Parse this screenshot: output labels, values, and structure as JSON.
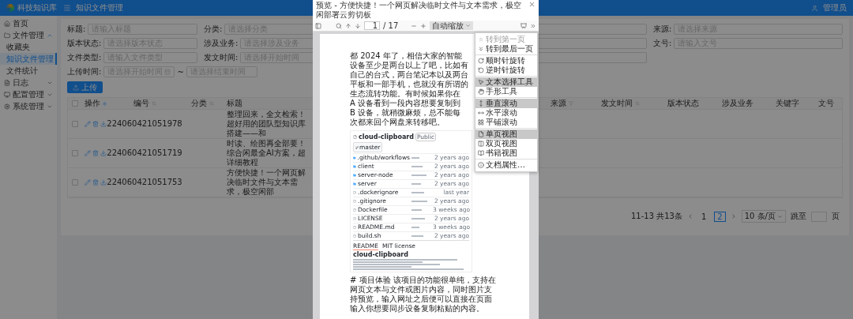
{
  "app": {
    "logo": "科技知识库",
    "breadcrumb": "知识文件管理",
    "user": "管理员"
  },
  "sidebar": {
    "items": [
      {
        "label": "首页",
        "kind": "link",
        "selected": false
      },
      {
        "label": "文件管理",
        "kind": "group",
        "expanded": true,
        "children": [
          {
            "label": "收藏夹",
            "selected": false
          },
          {
            "label": "知识文件管理",
            "selected": true
          },
          {
            "label": "文件统计",
            "selected": false
          }
        ]
      },
      {
        "label": "日志",
        "kind": "group",
        "expanded": false
      },
      {
        "label": "配置管理",
        "kind": "group",
        "expanded": false
      },
      {
        "label": "系统管理",
        "kind": "group",
        "expanded": false
      }
    ]
  },
  "filters": [
    {
      "label": "标题:",
      "kind": "input",
      "placeholder": "请输入标题"
    },
    {
      "label": "分类:",
      "kind": "select",
      "placeholder": "请选择分类"
    },
    {
      "label": "来源:",
      "kind": "select",
      "placeholder": "请选择来源"
    },
    {
      "label": "版本状态:",
      "kind": "select",
      "placeholder": "请选择版本状态"
    },
    {
      "label": "涉及业务:",
      "kind": "select",
      "placeholder": "请选择涉及业务"
    },
    {
      "label": "文号:",
      "kind": "input",
      "placeholder": "请输入文号"
    },
    {
      "label": "文件类型:",
      "kind": "input",
      "placeholder": "请输入文件类型"
    },
    {
      "label": "发文时间:",
      "kind": "select",
      "placeholder": "请选择开始时间"
    },
    {
      "label": "上传时间:",
      "kind": "range",
      "placeholder": "请选择开始时间",
      "placeholder_end": "请选择结束时间",
      "separator": "~"
    }
  ],
  "upload_button": "上传",
  "table": {
    "all_checked": false,
    "columns": [
      {
        "label": "操作",
        "kind": "actions"
      },
      {
        "label": "编号",
        "kind": "sort"
      },
      {
        "label": "分类",
        "kind": "sort"
      },
      {
        "label": "标题",
        "kind": "plain"
      },
      {
        "label": "来源",
        "kind": "filter"
      },
      {
        "label": "发文时间",
        "kind": "sort"
      },
      {
        "label": "版本状态",
        "kind": "plain"
      },
      {
        "label": "涉及业务",
        "kind": "plain"
      },
      {
        "label": "关键字",
        "kind": "plain"
      },
      {
        "label": "文号",
        "kind": "plain"
      }
    ],
    "rows": [
      {
        "checked": false,
        "id": "224060421051978",
        "title": "整理回来，全文检索！超好用的团队型知识库搭建——和"
      },
      {
        "checked": false,
        "id": "224060421051719",
        "title": "时读、绘图再全部要！综合闲最全AI方案，超详细教程"
      },
      {
        "checked": false,
        "id": "224060421051753",
        "title": "方便快捷！一个网页解决临时文件与文本需求，极空闲部"
      }
    ]
  },
  "pagination": {
    "summary": "11-13 共13条",
    "pages": [
      {
        "label": "1",
        "selected": false
      },
      {
        "label": "2",
        "selected": true
      }
    ],
    "page_size": "10 条/页",
    "jump_label": "跳至",
    "page_suffix": "页"
  },
  "viewer": {
    "title": "预览 - 方便快捷！一个网页解决临时文件与文本需求，极空闲部署云剪切板",
    "page_number": "1",
    "page_count": "/ 17",
    "zoom": "自动缩放",
    "menu_groups": [
      {
        "items": [
          {
            "label": "转到第一页",
            "disabled": true,
            "selected": false
          },
          {
            "label": "转到最后一页",
            "disabled": false,
            "selected": false
          }
        ]
      },
      {
        "items": [
          {
            "label": "顺时针旋转",
            "disabled": false,
            "selected": false
          },
          {
            "label": "逆时针旋转",
            "disabled": false,
            "selected": false
          }
        ]
      },
      {
        "items": [
          {
            "label": "文本选择工具",
            "disabled": false,
            "selected": true
          },
          {
            "label": "手形工具",
            "disabled": false,
            "selected": false
          }
        ]
      },
      {
        "items": [
          {
            "label": "垂直滚动",
            "disabled": false,
            "selected": true
          },
          {
            "label": "水平滚动",
            "disabled": false,
            "selected": false
          },
          {
            "label": "平铺滚动",
            "disabled": false,
            "selected": false
          }
        ]
      },
      {
        "items": [
          {
            "label": "单页视图",
            "disabled": false,
            "selected": true
          },
          {
            "label": "双页视图",
            "disabled": false,
            "selected": false
          },
          {
            "label": "书籍视图",
            "disabled": false,
            "selected": false
          }
        ]
      },
      {
        "items": [
          {
            "label": "文档属性…",
            "disabled": false,
            "selected": false
          }
        ]
      }
    ],
    "intro": "都 2024 年了，相信大家的智能设备至少是两台以上了吧，比如有自己的台式，两台笔记本以及两台平板和一部手机，也就没有所谓的生态流转功能。有时候如果你在 A 设备看到一段内容想要复制到 B 设备，就稍微麻烦，总不能每次都来回个网盘来转移吧。",
    "repo": {
      "name": "cloud-clipboard",
      "visibility": "Public",
      "branch": "master",
      "files": [
        {
          "name": ".github/workflows",
          "kind": "folder",
          "age": "2 years ago"
        },
        {
          "name": "client",
          "kind": "folder",
          "age": "2 years ago"
        },
        {
          "name": "server-node",
          "kind": "folder",
          "age": "2 years ago"
        },
        {
          "name": "server",
          "kind": "folder",
          "age": "2 years ago"
        },
        {
          "name": ".dockerignore",
          "kind": "file",
          "age": "last year"
        },
        {
          "name": ".gitignore",
          "kind": "file",
          "age": "2 years ago"
        },
        {
          "name": "Dockerfile",
          "kind": "file",
          "age": "3 weeks ago"
        },
        {
          "name": "LICENSE",
          "kind": "file",
          "age": "2 years ago"
        },
        {
          "name": "README.md",
          "kind": "file",
          "age": "3 weeks ago"
        },
        {
          "name": "build.sh",
          "kind": "file",
          "age": "2 years ago"
        }
      ],
      "readme_tabs": [
        "README",
        "MIT license"
      ],
      "readme_title": "cloud-clipboard"
    },
    "outro": "# 项目体验 该项目的功能很单纯，支持在网页文本与文件或图片内容，同时图片支持预览，输入网址之后便可以直接在页面输入你想要同步设备复制粘贴的内容。"
  }
}
